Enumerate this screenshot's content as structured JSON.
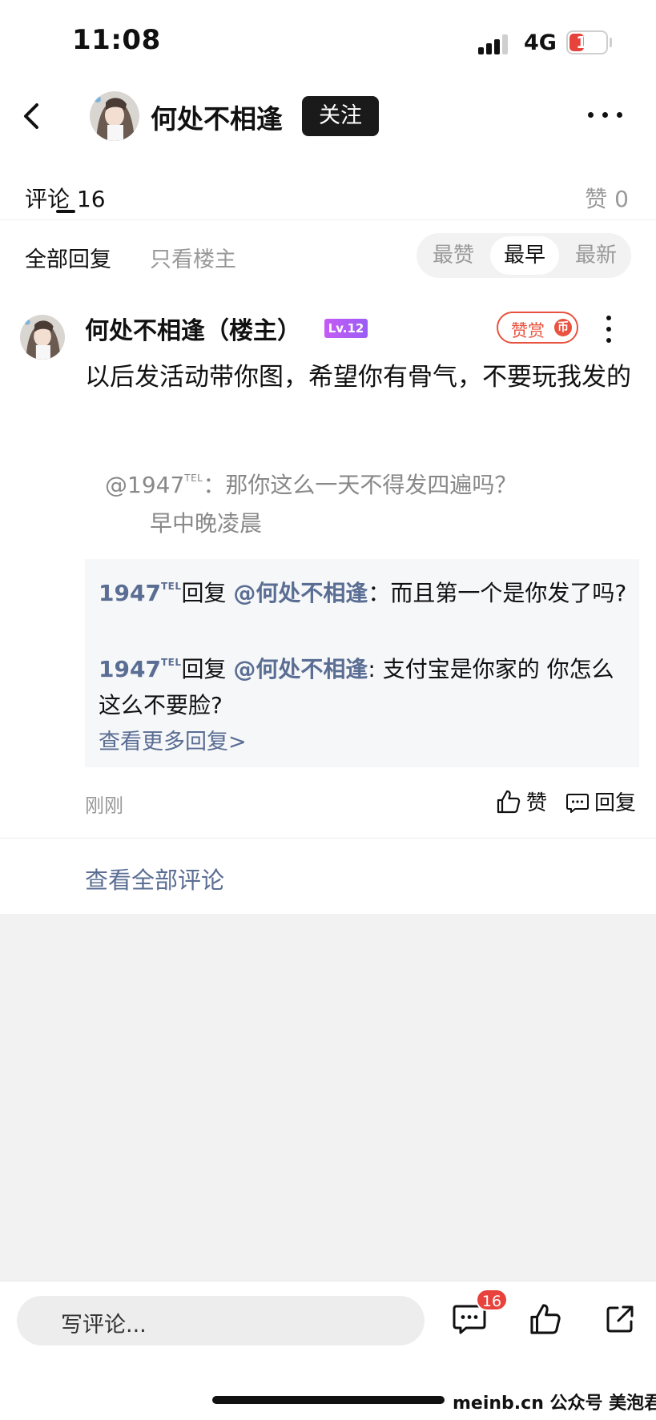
{
  "status_bar": {
    "time": "11:08",
    "network": "4G",
    "battery_level": "14",
    "battery_color": "#e8423c"
  },
  "header": {
    "back_icon": "chevron-left-icon",
    "title": "何处不相逢",
    "follow_label": "关注",
    "more_icon": "more-horizontal-icon"
  },
  "tabs": {
    "comments_label": "评论 16",
    "likes_label": "赞 0"
  },
  "filters": {
    "all_replies": "全部回复",
    "op_only": "只看楼主",
    "sort_options": [
      "最赞",
      "最早",
      "最新"
    ],
    "sort_selected": "最早"
  },
  "comment": {
    "author": "何处不相逢（楼主）",
    "level": "Lv.12",
    "tip_label": "赞赏",
    "tip_coin": "币",
    "text": "以后发活动带你图，希望你有骨气，不要玩我发的",
    "quote": {
      "user": "@1947",
      "user_sup": "TEL",
      "text": "：那你这么一天不得发四遍吗？",
      "tail": "早中晚凌晨"
    },
    "replies": [
      {
        "user": "1947",
        "user_sup": "TEL",
        "reply_word": "回复",
        "mention": "@何处不相逢",
        "text": "：而且第一个是你发了吗?"
      },
      {
        "user": "1947",
        "user_sup": "TEL",
        "reply_word": "回复",
        "mention": "@何处不相逢",
        "text": ": 支付宝是你家的   你怎么这么不要脸?"
      }
    ],
    "more_replies": "查看更多回复>",
    "time": "刚刚",
    "like_label": "赞",
    "reply_label": "回复"
  },
  "view_all_comments": "查看全部评论",
  "bottom_bar": {
    "input_placeholder": "写评论...",
    "comment_count": "16",
    "accent_color": "#5a6d93"
  },
  "watermark": "meinb.cn  公众号 美泡君"
}
